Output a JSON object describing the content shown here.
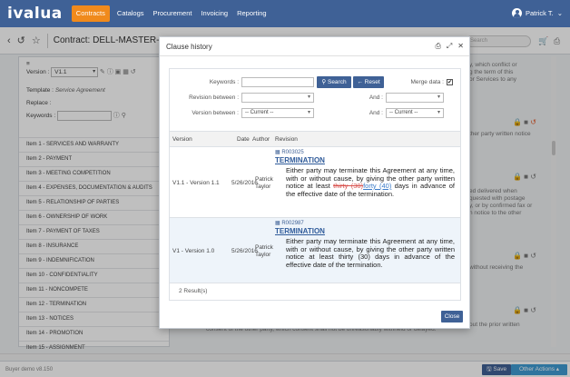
{
  "app": {
    "logo": "ivalua",
    "nav": [
      "Contracts",
      "Catalogs",
      "Procurement",
      "Invoicing",
      "Reporting"
    ],
    "user": "Patrick T."
  },
  "subheader": {
    "contract_title": "Contract: DELL-MASTER-",
    "search_placeholder": "Search"
  },
  "left_panel": {
    "version_label": "Version :",
    "version_value": "V1.1",
    "template_label": "Template :",
    "template_value": "Service Agreement",
    "replace_label": "Replace :",
    "keywords_label": "Keywords :",
    "items": [
      "Item 1 - SERVICES AND WARRANTY",
      "Item 2 - PAYMENT",
      "Item 3 - MEETING COMPETITION",
      "Item 4 - EXPENSES, DOCUMENTATION & AUDITS",
      "Item 5 - RELATIONSHIP OF PARTIES",
      "Item 6 - OWNERSHIP OF WORK",
      "Item 7 - PAYMENT OF TAXES",
      "Item 8 - INSURANCE",
      "Item 9 - INDEMNIFICATION",
      "Item 10 - CONFIDENTIALITY",
      "Item 11 - NONCOMPETE",
      "Item 12 - TERMINATION",
      "Item 13 - NOTICES",
      "Item 14 - PROMOTION",
      "Item 15 - ASSIGNMENT"
    ]
  },
  "background_text": {
    "r1": "y, which conflict or",
    "r2": "g the term of this",
    "r3": "or Services to any",
    "r4": "ther party written notice",
    "r5": "ed delivered when",
    "r6": "quested with postage",
    "r7": "y, or by confirmed fax or",
    "r8": "n notice to the other",
    "r9": "without receiving the",
    "r10": "out the prior written",
    "bottom": "consent of the other party, which consent shall not be unreasonably withheld or delayed."
  },
  "footer": {
    "version": "Buyer demo v8.150",
    "save": "Save",
    "other_actions": "Other Actions"
  },
  "modal": {
    "title": "Clause history",
    "keywords_label": "Keywords :",
    "search_button": "Search",
    "reset_button": "Reset",
    "merge_label": "Merge data :",
    "revision_between_label": "Revision between :",
    "version_between_label": "Version between :",
    "and_label": "And :",
    "current_option": "-- Current --",
    "columns": [
      "Version",
      "Date",
      "Author",
      "Revision"
    ],
    "rows": [
      {
        "version": "V1.1 - Version 1.1",
        "date": "5/26/2016",
        "author": "Patrick Taylor",
        "revision_id": "R003025",
        "heading": "TERMINATION",
        "text_before": "Either party may terminate this Agreement at any time, with or without cause, by giving the other party written notice at least ",
        "deleted": "thirty (30)",
        "inserted": "forty (40)",
        "text_after": " days in advance of the effective date of the termination."
      },
      {
        "version": "V1 - Version 1.0",
        "date": "5/26/2016",
        "author": "Patrick Taylor",
        "revision_id": "R002987",
        "heading": "TERMINATION",
        "text": "Either party may terminate this Agreement at any time, with or without cause, by giving the other party written notice at least thirty (30) days in advance of the effective date of the termination."
      }
    ],
    "result_count": "2 Result(s)",
    "close_button": "Close"
  },
  "colors": {
    "nav_bg": "#3f6196",
    "accent": "#f08a1c",
    "button": "#3f6196",
    "other_actions": "#3f9bd3"
  }
}
